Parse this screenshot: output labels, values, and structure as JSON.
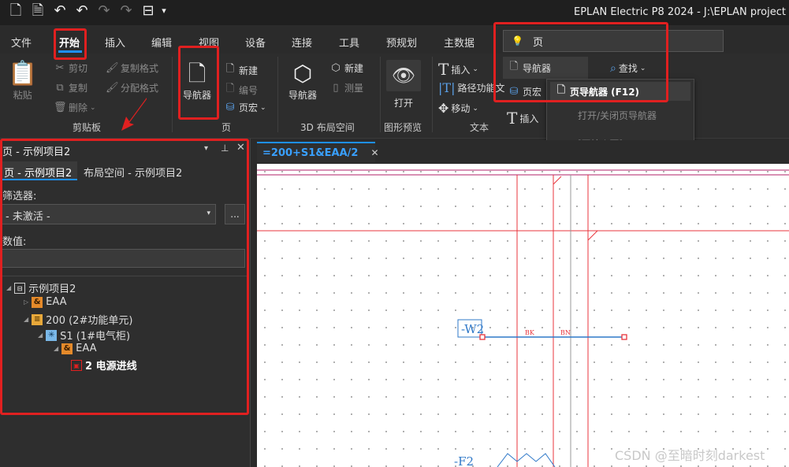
{
  "titlebar": {
    "title": "EPLAN Electric P8 2024 - J:\\EPLAN project",
    "quick_access_dropdown": "▾"
  },
  "menu_tabs": [
    "文件",
    "开始",
    "插入",
    "编辑",
    "视图",
    "设备",
    "连接",
    "工具",
    "预规划",
    "主数据"
  ],
  "search": {
    "value": "页"
  },
  "ribbon": {
    "clipboard": {
      "paste": "粘贴",
      "cut": "剪切",
      "copy": "复制",
      "delete": "删除",
      "copy_format": "复制格式",
      "assign_format": "分配格式",
      "label": "剪贴板"
    },
    "page": {
      "navigator": "导航器",
      "new": "新建",
      "number": "编号",
      "macro": "页宏",
      "label": "页"
    },
    "layout3d": {
      "navigator": "导航器",
      "new": "新建",
      "measure": "测量",
      "label": "3D 布局空间"
    },
    "preview": {
      "open": "打开",
      "label": "图形预览"
    },
    "text": {
      "insert": "插入",
      "path_func": "路径功能文",
      "move": "移动",
      "insert2": "插入",
      "label": "文本"
    },
    "search_results": {
      "navigator": "导航器",
      "page_partial": "页宏",
      "find": "查找"
    }
  },
  "dropdown": {
    "item1": "页导航器 (F12)",
    "item2": "打开/关闭页导航器",
    "item3": "[开始 | 页]"
  },
  "panel": {
    "title": "页 - 示例项目2",
    "tabs": [
      "页 - 示例项目2",
      "布局空间 - 示例项目2"
    ],
    "filter_label": "筛选器:",
    "filter_value": "- 未激活 -",
    "filter_more": "...",
    "value_label": "数值:",
    "value_input": "",
    "tree": [
      {
        "label": "示例项目2",
        "level": 0,
        "icon": "project-icon",
        "bold": false
      },
      {
        "label": "EAA",
        "level": 1,
        "icon": "location-icon",
        "bold": false
      },
      {
        "label": "200 (2#功能单元)",
        "level": 1,
        "icon": "function-icon",
        "bold": false
      },
      {
        "label": "S1 (1#电气柜)",
        "level": 2,
        "icon": "cabinet-icon",
        "bold": false
      },
      {
        "label": "EAA",
        "level": 3,
        "icon": "location-icon",
        "bold": false
      },
      {
        "label": "2 电源进线",
        "level": 4,
        "icon": "page-icon",
        "bold": true
      }
    ]
  },
  "doc_tab": {
    "label": "=200+S1&EAA/2"
  },
  "schematic": {
    "cable_tag": "-W2",
    "wire1": "BK",
    "wire2": "BN",
    "fuse_tag": "-F2"
  },
  "watermark": "CSDN @至暗时刻darkest",
  "colors": {
    "accent": "#1e90ff",
    "highlight_box": "#e02020",
    "schematic_red": "#e8343c",
    "schematic_blue": "#2f78c8",
    "border_magenta": "#b0206a"
  }
}
